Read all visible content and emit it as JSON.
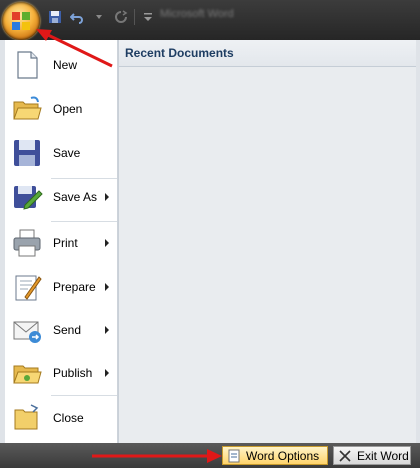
{
  "quick_access": {
    "icons": [
      "save-icon",
      "undo-icon",
      "redo-icon",
      "customize-icon"
    ],
    "title_text": "Microsoft Word"
  },
  "recent_documents": {
    "header": "Recent Documents"
  },
  "menu": {
    "items": [
      {
        "label": "New",
        "has_submenu": false,
        "icon": "new-document-icon"
      },
      {
        "label": "Open",
        "has_submenu": false,
        "icon": "open-folder-icon"
      },
      {
        "label": "Save",
        "has_submenu": false,
        "icon": "save-disk-icon"
      },
      {
        "label": "Save As",
        "has_submenu": true,
        "icon": "save-as-icon"
      },
      {
        "label": "Print",
        "has_submenu": true,
        "icon": "printer-icon"
      },
      {
        "label": "Prepare",
        "has_submenu": true,
        "icon": "prepare-icon"
      },
      {
        "label": "Send",
        "has_submenu": true,
        "icon": "send-icon"
      },
      {
        "label": "Publish",
        "has_submenu": true,
        "icon": "publish-icon"
      },
      {
        "label": "Close",
        "has_submenu": false,
        "icon": "close-folder-icon"
      }
    ]
  },
  "bottom": {
    "word_options": "Word Options",
    "exit_word": "Exit Word"
  },
  "colors": {
    "annotation_arrow": "#e01818",
    "office_button": "#f6b13b",
    "header_text": "#1e3d62"
  }
}
